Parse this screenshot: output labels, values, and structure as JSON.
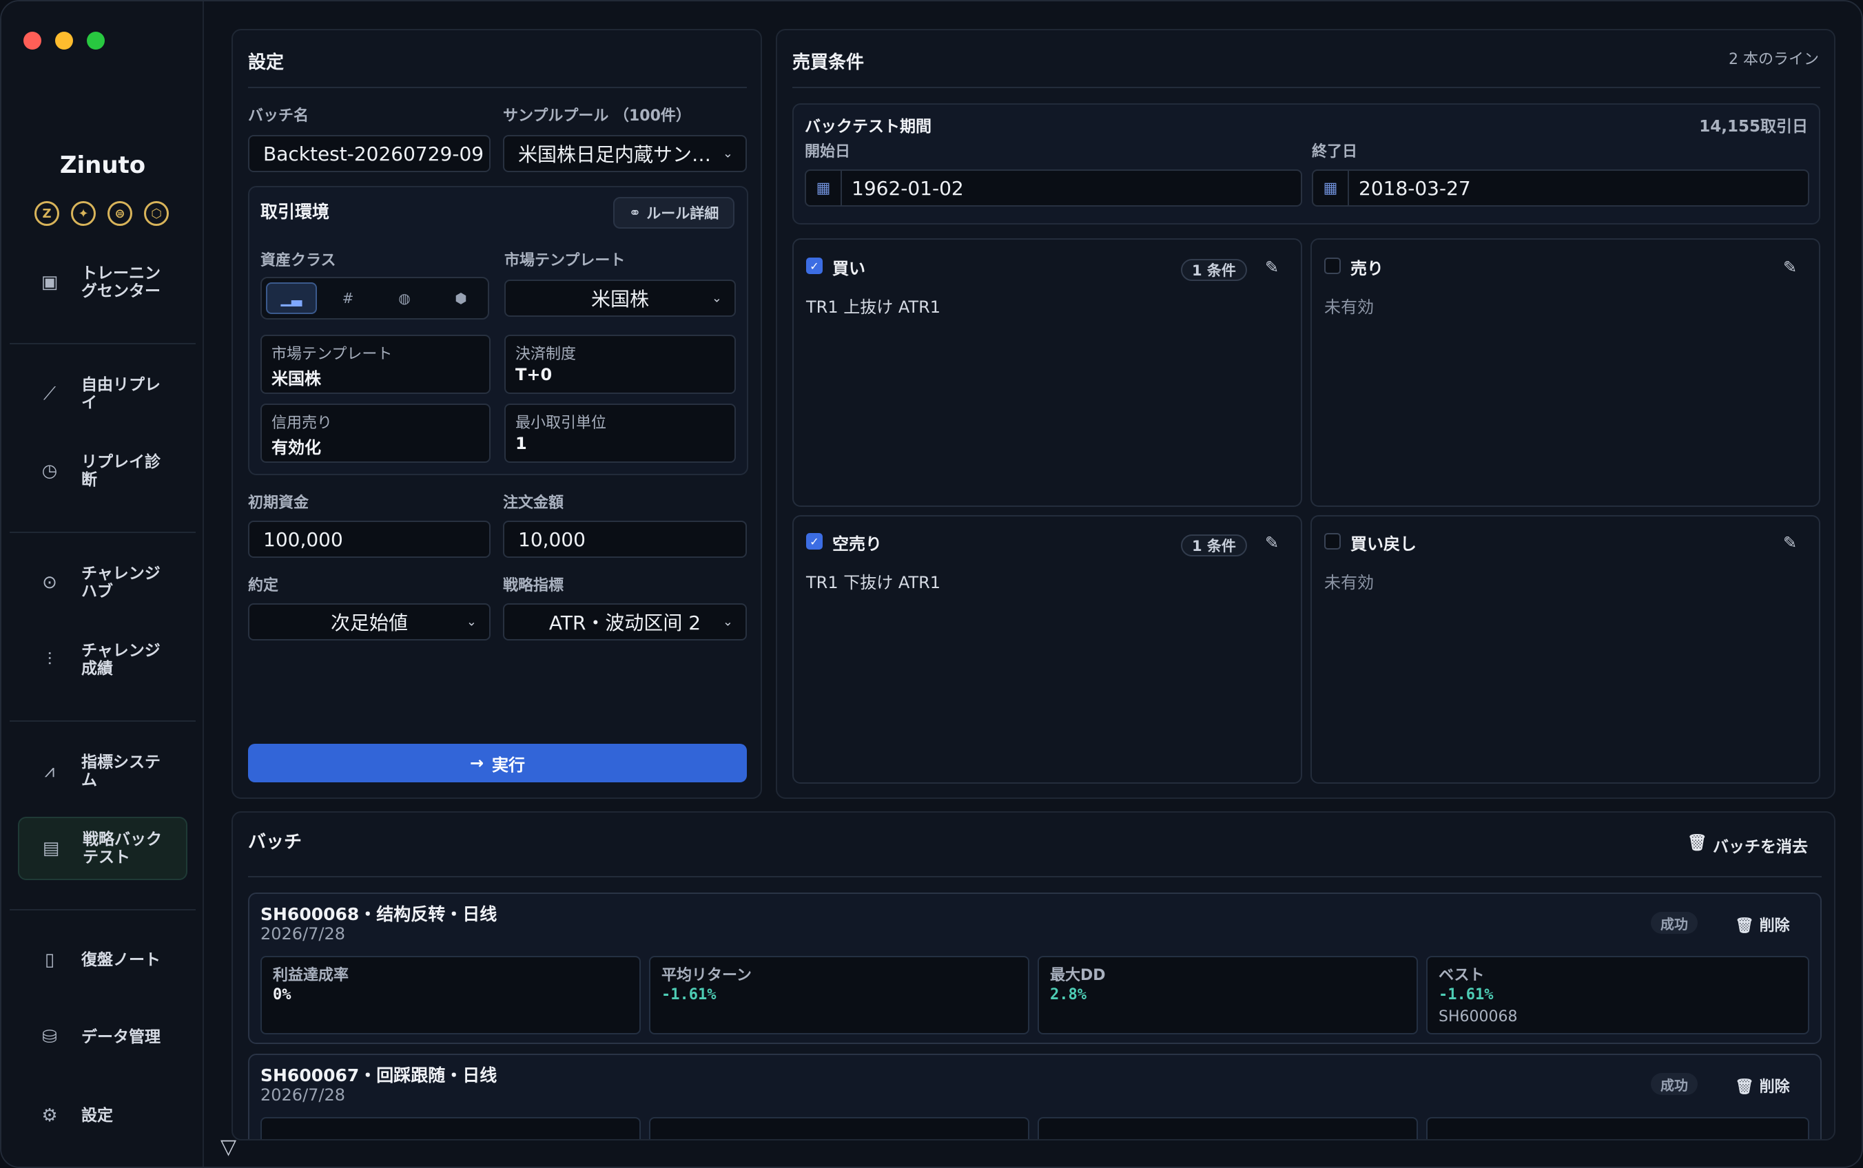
{
  "app": {
    "name": "Zinuto",
    "brand_icons": [
      "Z",
      "✦",
      "⊜",
      "⬡"
    ]
  },
  "sidebar": {
    "items": [
      {
        "label": "トレーニングセンター",
        "icon": "chart-box-icon"
      },
      {
        "label": "自由リプレイ",
        "icon": "trend-icon"
      },
      {
        "label": "リプレイ診断",
        "icon": "history-icon"
      },
      {
        "label": "チャレンジハブ",
        "icon": "target-icon"
      },
      {
        "label": "チャレンジ成績",
        "icon": "bar-person-icon"
      },
      {
        "label": "指標システム",
        "icon": "line-chart-icon"
      },
      {
        "label": "戦略バックテスト",
        "icon": "backtest-icon",
        "active": true
      },
      {
        "label": "復盤ノート",
        "icon": "document-icon"
      },
      {
        "label": "データ管理",
        "icon": "database-icon"
      },
      {
        "label": "設定",
        "icon": "gear-icon"
      }
    ]
  },
  "settings": {
    "title": "設定",
    "batch_name_label": "バッチ名",
    "batch_name_value": "Backtest-20260729-09",
    "sample_pool_label": "サンプルプール （100件）",
    "sample_pool_value": "米国株日足内蔵サン…",
    "env": {
      "title": "取引環境",
      "rule_button": "ルール詳細",
      "asset_class_label": "資産クラス",
      "market_template_label": "市場テンプレート",
      "market_template_value": "米国株",
      "info": [
        {
          "key": "市場テンプレート",
          "value": "米国株"
        },
        {
          "key": "決済制度",
          "value": "T+0"
        },
        {
          "key": "信用売り",
          "value": "有効化"
        },
        {
          "key": "最小取引単位",
          "value": "1"
        }
      ]
    },
    "initial_capital_label": "初期資金",
    "initial_capital_value": "100,000",
    "order_amount_label": "注文金額",
    "order_amount_value": "10,000",
    "fill_label": "約定",
    "fill_value": "次足始値",
    "strategy_label": "戦略指標",
    "strategy_value": "ATR・波动区间 2",
    "run_button": "実行"
  },
  "conditions": {
    "title": "売買条件",
    "line_count": "2 本のライン",
    "period": {
      "title": "バックテスト期間",
      "trading_days": "14,155取引日",
      "start_label": "開始日",
      "start_value": "1962-01-02",
      "end_label": "終了日",
      "end_value": "2018-03-27"
    },
    "cards": [
      {
        "title": "買い",
        "checked": true,
        "pill": "1 条件",
        "body": "TR1 上抜け ATR1"
      },
      {
        "title": "売り",
        "checked": false,
        "pill": "",
        "body": "未有効"
      },
      {
        "title": "空売り",
        "checked": true,
        "pill": "1 条件",
        "body": "TR1 下抜け ATR1"
      },
      {
        "title": "買い戻し",
        "checked": false,
        "pill": "",
        "body": "未有効"
      }
    ]
  },
  "batch": {
    "title": "バッチ",
    "clear_button": "バッチを消去",
    "items": [
      {
        "title": "SH600068・结构反转・日线",
        "date": "2026/7/28",
        "status": "成功",
        "delete": "削除",
        "metrics": [
          {
            "key": "利益達成率",
            "value": "0%",
            "sub": ""
          },
          {
            "key": "平均リターン",
            "value": "-1.61%",
            "sub": ""
          },
          {
            "key": "最大DD",
            "value": "2.8%",
            "sub": ""
          },
          {
            "key": "ベスト",
            "value": "-1.61%",
            "sub": "SH600068"
          }
        ]
      },
      {
        "title": "SH600067・回踩跟随・日线",
        "date": "2026/7/28",
        "status": "成功",
        "delete": "削除"
      }
    ]
  }
}
